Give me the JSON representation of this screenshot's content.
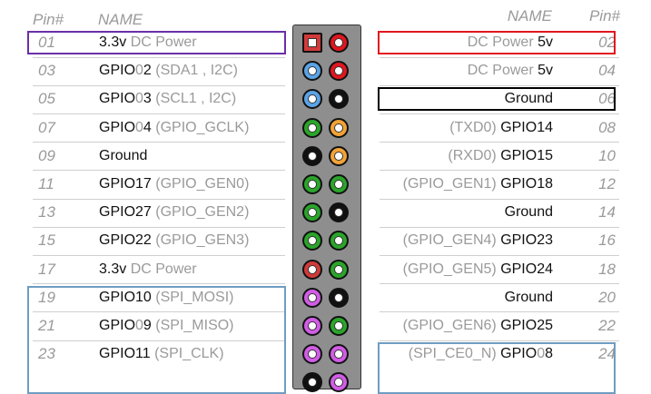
{
  "header": {
    "left_pin": "Pin#",
    "left_name": "NAME",
    "right_name": "NAME",
    "right_pin": "Pin#"
  },
  "colors": {
    "power_3v3": "#d13a3a",
    "power_5v": "#e0161f",
    "ground": "#111111",
    "i2c": "#5aa3e6",
    "gpio": "#2aa52a",
    "uart": "#f2a236",
    "spi": "#d25ce6",
    "highlight_purple": "#6a2fa8",
    "highlight_red": "#e0161f",
    "highlight_black": "#000000",
    "highlight_blue": "#6f9dc2"
  },
  "rows": [
    {
      "left": {
        "pin": "01",
        "main": "3.3v",
        "sub": " DC Power",
        "type": "power_3v3",
        "square": true
      },
      "right": {
        "pin": "02",
        "sub": "DC Power ",
        "main": "5v",
        "type": "power_5v"
      }
    },
    {
      "left": {
        "pin": "03",
        "main": "GPIO",
        "dim": "0",
        "main2": "2",
        "sub": " (SDA1 , I2C)",
        "type": "i2c"
      },
      "right": {
        "pin": "04",
        "sub": "DC Power ",
        "main": "5v",
        "type": "power_5v"
      }
    },
    {
      "left": {
        "pin": "05",
        "main": "GPIO",
        "dim": "0",
        "main2": "3",
        "sub": " (SCL1 , I2C)",
        "type": "i2c"
      },
      "right": {
        "pin": "06",
        "sub": "",
        "main": "Ground",
        "type": "ground"
      }
    },
    {
      "left": {
        "pin": "07",
        "main": "GPIO",
        "dim": "0",
        "main2": "4",
        "sub": " (GPIO_GCLK)",
        "type": "gpio"
      },
      "right": {
        "pin": "08",
        "sub": "(TXD0) ",
        "main": "GPIO14",
        "type": "uart"
      }
    },
    {
      "left": {
        "pin": "09",
        "main": "Ground",
        "sub": "",
        "type": "ground"
      },
      "right": {
        "pin": "10",
        "sub": "(RXD0) ",
        "main": "GPIO15",
        "type": "uart"
      }
    },
    {
      "left": {
        "pin": "11",
        "main": "GPIO17",
        "sub": " (GPIO_GEN0)",
        "type": "gpio"
      },
      "right": {
        "pin": "12",
        "sub": "(GPIO_GEN1) ",
        "main": "GPIO18",
        "type": "gpio"
      }
    },
    {
      "left": {
        "pin": "13",
        "main": "GPIO27",
        "sub": " (GPIO_GEN2)",
        "type": "gpio"
      },
      "right": {
        "pin": "14",
        "sub": "",
        "main": "Ground",
        "type": "ground"
      }
    },
    {
      "left": {
        "pin": "15",
        "main": "GPIO22",
        "sub": " (GPIO_GEN3)",
        "type": "gpio"
      },
      "right": {
        "pin": "16",
        "sub": "(GPIO_GEN4) ",
        "main": "GPIO23",
        "type": "gpio"
      }
    },
    {
      "left": {
        "pin": "17",
        "main": "3.3v",
        "sub": " DC Power",
        "type": "power_3v3"
      },
      "right": {
        "pin": "18",
        "sub": "(GPIO_GEN5) ",
        "main": "GPIO24",
        "type": "gpio"
      }
    },
    {
      "left": {
        "pin": "19",
        "main": "GPIO10",
        "sub": " (SPI_MOSI)",
        "type": "spi"
      },
      "right": {
        "pin": "20",
        "sub": "",
        "main": "Ground",
        "type": "ground"
      }
    },
    {
      "left": {
        "pin": "21",
        "main": "GPIO",
        "dim": "0",
        "main2": "9",
        "sub": " (SPI_MISO)",
        "type": "spi"
      },
      "right": {
        "pin": "22",
        "sub": "(GPIO_GEN6) ",
        "main": "GPIO25",
        "type": "gpio"
      }
    },
    {
      "left": {
        "pin": "23",
        "main": "GPIO11",
        "sub": " (SPI_CLK)",
        "type": "spi"
      },
      "right": {
        "pin": "24",
        "sub": "(SPI_CE0_N) ",
        "main": "GPIO",
        "dim": "0",
        "main2": "8",
        "type": "spi"
      }
    },
    {
      "left": {
        "type": "ground"
      },
      "right": {
        "type": "spi"
      }
    }
  ],
  "highlights": [
    {
      "side": "left",
      "rows": [
        0,
        0
      ],
      "color": "highlight_purple"
    },
    {
      "side": "right",
      "rows": [
        0,
        0
      ],
      "color": "highlight_red"
    },
    {
      "side": "right",
      "rows": [
        2,
        2
      ],
      "color": "highlight_black"
    },
    {
      "side": "left",
      "rows": [
        9,
        12
      ],
      "color": "highlight_blue"
    },
    {
      "side": "right",
      "rows": [
        11,
        12
      ],
      "color": "highlight_blue"
    }
  ]
}
